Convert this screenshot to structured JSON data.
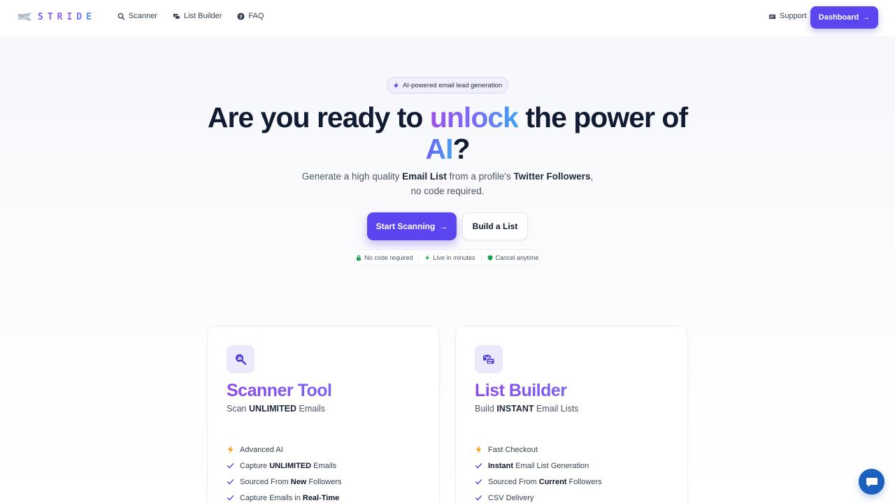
{
  "brand": {
    "name": "STRIDE",
    "icon": "envelope-wings-icon"
  },
  "nav": {
    "items": [
      {
        "label": "Scanner",
        "icon": "search-icon"
      },
      {
        "label": "List Builder",
        "icon": "list-builder-icon"
      },
      {
        "label": "FAQ",
        "icon": "question-icon"
      }
    ],
    "support": {
      "label": "Support",
      "icon": "support-icon"
    },
    "dashboard": {
      "label": "Dashboard",
      "arrow": "→"
    }
  },
  "hero": {
    "badge": "AI-powered email lead generation",
    "title": {
      "part1": "Are you ready to ",
      "highlight": "unlock",
      "part2": " the power of ",
      "ai": "AI",
      "end": "?"
    },
    "subtitle": {
      "p1": "Generate a high quality ",
      "b1": "Email List",
      "p2": " from a profile's ",
      "b2": "Twitter Followers",
      "p3": ",",
      "line2": "no code required."
    },
    "primary_cta": "Start Scanning",
    "primary_arrow": "→",
    "secondary_cta": "Build a List",
    "features": [
      {
        "label": "No code required",
        "icon": "lock-icon"
      },
      {
        "label": "Live in minutes",
        "icon": "bolt-icon"
      },
      {
        "label": "Cancel anytime",
        "icon": "shield-icon"
      }
    ]
  },
  "cards": [
    {
      "title": "Scanner Tool",
      "sub": {
        "p1": "Scan ",
        "b": "UNLIMITED",
        "p2": " Emails"
      },
      "icon": "chart-search-icon",
      "items": [
        {
          "icon": "bolt-icon",
          "p1": "Advanced AI",
          "b": "",
          "p2": ""
        },
        {
          "icon": "check-icon",
          "p1": "Capture ",
          "b": "UNLIMITED",
          "p2": " Emails"
        },
        {
          "icon": "check-icon",
          "p1": "Sourced From ",
          "b": "New",
          "p2": " Followers"
        },
        {
          "icon": "check-icon",
          "p1": "Capture Emails in ",
          "b": "Real-Time",
          "p2": ""
        }
      ]
    },
    {
      "title": "List Builder",
      "sub": {
        "p1": "Build ",
        "b": "INSTANT",
        "p2": " Email Lists"
      },
      "icon": "mail-list-icon",
      "items": [
        {
          "icon": "bolt-icon",
          "p1": "Fast Checkout",
          "b": "",
          "p2": ""
        },
        {
          "icon": "check-icon",
          "p1": "",
          "b": "Instant",
          "p2": " Email List Generation"
        },
        {
          "icon": "check-icon",
          "p1": "Sourced From ",
          "b": "Current",
          "p2": " Followers"
        },
        {
          "icon": "check-icon",
          "p1": "CSV Delivery",
          "b": "",
          "p2": ""
        }
      ]
    }
  ],
  "chat": {
    "icon": "chat-bubble-icon"
  },
  "colors": {
    "accent": "#5b45ef",
    "title_gradient_start": "#9b4ff0",
    "title_gradient_end": "#3ea2ef",
    "chat": "#1b5fbf",
    "bolt": "#f59e0b"
  }
}
